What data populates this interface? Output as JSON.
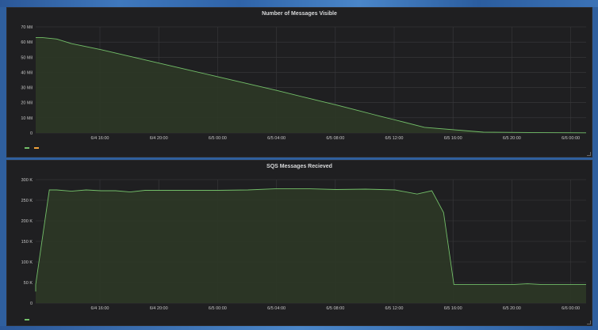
{
  "colors": {
    "series": "#73bf69",
    "fill": "#2c3726",
    "legend_orange": "#f2a33c"
  },
  "panel1": {
    "title": "Number of Messages Visible",
    "legend": [
      {
        "name": "",
        "color": "#73bf69"
      },
      {
        "name": "",
        "color": "#f2a33c"
      }
    ]
  },
  "panel2": {
    "title": "SQS Messages Recieved",
    "legend": [
      {
        "name": "",
        "color": "#73bf69"
      }
    ]
  },
  "chart_data": [
    {
      "type": "area",
      "title": "Number of Messages Visible",
      "x_ticks": [
        "6/4 16:00",
        "6/4 20:00",
        "6/5 00:00",
        "6/5 04:00",
        "6/5 08:00",
        "6/5 12:00",
        "6/5 16:00",
        "6/5 20:00",
        "6/6 00:00"
      ],
      "y_ticks": [
        "0",
        "10 Mil",
        "20 Mil",
        "30 Mil",
        "40 Mil",
        "50 Mil",
        "60 Mil",
        "70 Mil"
      ],
      "ylim": [
        0,
        70
      ],
      "xlim": [
        -3,
        24.7
      ],
      "grid": true,
      "series": [
        {
          "name": "",
          "x": [
            -3,
            -2,
            -1,
            0,
            2,
            4,
            6,
            8,
            10,
            12,
            14,
            16,
            18,
            19.5,
            20.5,
            21,
            22,
            24,
            28,
            32,
            36,
            40,
            44.7
          ],
          "y": [
            63,
            63,
            62,
            59,
            55,
            50.5,
            46,
            41.5,
            37,
            32.5,
            28,
            23.2,
            18.5,
            14.8,
            12.3,
            11,
            8.6,
            3.7,
            0.5,
            0.2,
            0.1,
            0.1,
            0.1
          ]
        }
      ]
    },
    {
      "type": "area",
      "title": "SQS Messages Recieved",
      "x_ticks": [
        "6/4 16:00",
        "6/4 20:00",
        "6/5 00:00",
        "6/5 04:00",
        "6/5 08:00",
        "6/5 12:00",
        "6/5 16:00",
        "6/5 20:00",
        "6/6 00:00"
      ],
      "y_ticks": [
        "0",
        "50 K",
        "100 K",
        "150 K",
        "200 K",
        "250 K",
        "300 K"
      ],
      "ylim": [
        0,
        300
      ],
      "grid": true,
      "series": [
        {
          "name": "",
          "x": [
            -3,
            -2.5,
            -1.5,
            -1,
            0,
            1,
            2,
            3,
            4,
            5,
            6,
            8,
            10,
            12,
            14,
            16,
            18,
            20,
            22,
            23.5,
            24.5,
            25.3,
            26,
            27,
            28,
            30,
            31,
            32,
            34,
            36,
            38,
            40,
            44.5
          ],
          "y": [
            28,
            45,
            275,
            275,
            272,
            275,
            273,
            273,
            270,
            274,
            274,
            274,
            274,
            275,
            278,
            278,
            276,
            277,
            275,
            265,
            273,
            220,
            45,
            45,
            45,
            45,
            47,
            45,
            45,
            45,
            45,
            45,
            45
          ]
        }
      ]
    }
  ]
}
